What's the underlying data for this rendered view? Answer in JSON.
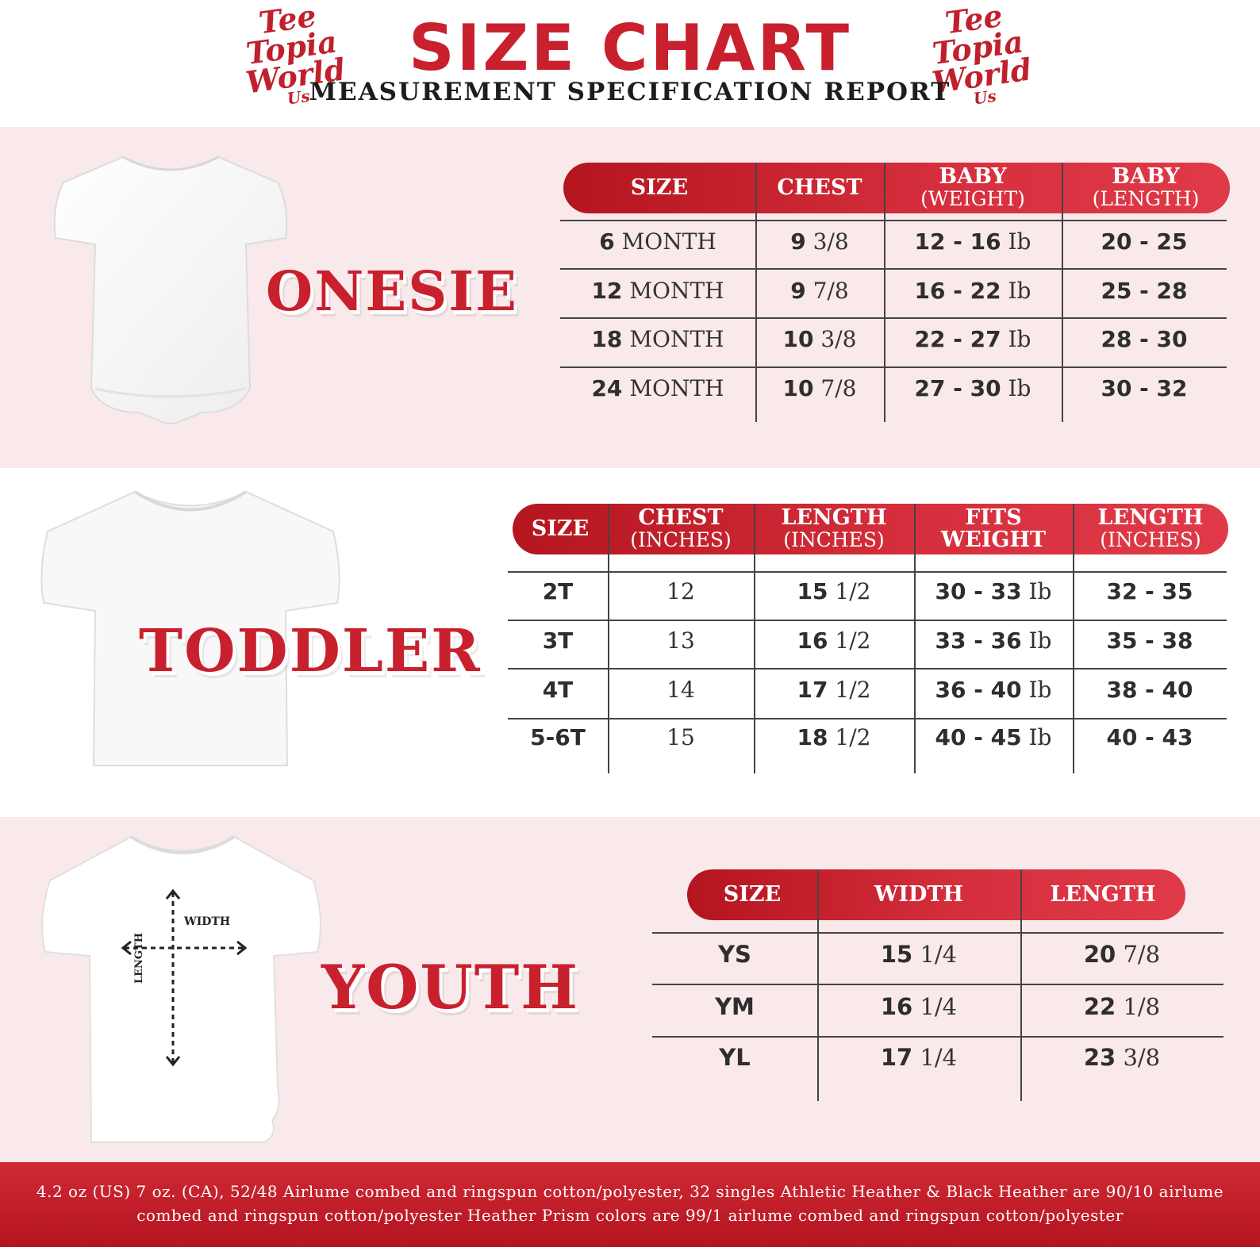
{
  "brand": {
    "line1": "Tee",
    "line2": "Topia",
    "line3": "World",
    "line4": "Us"
  },
  "header": {
    "title": "SIZE CHART",
    "subtitle": "MEASUREMENT SPECIFICATION REPORT"
  },
  "colors": {
    "accent": "#c8202d",
    "band": "#f9e9ea",
    "text": "#333333"
  },
  "onesie": {
    "label": "ONESIE",
    "headers": [
      {
        "main": "SIZE",
        "sub": ""
      },
      {
        "main": "CHEST",
        "sub": ""
      },
      {
        "main": "BABY",
        "sub": "(WEIGHT)"
      },
      {
        "main": "BABY",
        "sub": "(LENGTH)"
      }
    ],
    "rows": [
      [
        [
          "6",
          " MONTH"
        ],
        [
          "9",
          " 3/8"
        ],
        [
          "12 - 16",
          " Ib"
        ],
        [
          "20 - 25",
          ""
        ]
      ],
      [
        [
          "12",
          " MONTH"
        ],
        [
          "9",
          " 7/8"
        ],
        [
          "16 - 22",
          " Ib"
        ],
        [
          "25 - 28",
          ""
        ]
      ],
      [
        [
          "18",
          "  MONTH"
        ],
        [
          "10",
          " 3/8"
        ],
        [
          "22 - 27",
          " Ib"
        ],
        [
          "28 - 30",
          ""
        ]
      ],
      [
        [
          "24",
          " MONTH"
        ],
        [
          "10",
          " 7/8"
        ],
        [
          "27 - 30",
          " Ib"
        ],
        [
          "30 - 32",
          ""
        ]
      ]
    ]
  },
  "toddler": {
    "label": "TODDLER",
    "headers": [
      {
        "main": "SIZE",
        "sub": ""
      },
      {
        "main": "CHEST",
        "sub": "(INCHES)"
      },
      {
        "main": "LENGTH",
        "sub": "(INCHES)"
      },
      {
        "main": "FITS",
        "sub": "WEIGHT"
      },
      {
        "main": "LENGTH",
        "sub": "(INCHES)"
      }
    ],
    "rows": [
      [
        [
          "2T",
          ""
        ],
        [
          "",
          "12"
        ],
        [
          "15",
          " 1/2"
        ],
        [
          "30 - 33",
          " Ib"
        ],
        [
          "32 - 35",
          ""
        ]
      ],
      [
        [
          "3T",
          ""
        ],
        [
          "",
          "13"
        ],
        [
          "16",
          " 1/2"
        ],
        [
          "33 - 36",
          " Ib"
        ],
        [
          "35 - 38",
          ""
        ]
      ],
      [
        [
          "4T",
          ""
        ],
        [
          "",
          "14"
        ],
        [
          "17",
          " 1/2"
        ],
        [
          "36 - 40",
          " Ib"
        ],
        [
          "38 - 40",
          ""
        ]
      ],
      [
        [
          "5-6T",
          ""
        ],
        [
          "",
          "15"
        ],
        [
          "18",
          " 1/2"
        ],
        [
          "40 - 45",
          " Ib"
        ],
        [
          "40 - 43",
          ""
        ]
      ]
    ]
  },
  "youth": {
    "label": "YOUTH",
    "width_label": "WIDTH",
    "length_label": "LENGTH",
    "headers": [
      {
        "main": "SIZE",
        "sub": ""
      },
      {
        "main": "WIDTH",
        "sub": ""
      },
      {
        "main": "LENGTH",
        "sub": ""
      }
    ],
    "rows": [
      [
        [
          "YS",
          ""
        ],
        [
          "15",
          " 1/4"
        ],
        [
          "20",
          " 7/8"
        ]
      ],
      [
        [
          "YM",
          ""
        ],
        [
          "16",
          " 1/4"
        ],
        [
          "22",
          " 1/8"
        ]
      ],
      [
        [
          "YL",
          ""
        ],
        [
          "17",
          " 1/4"
        ],
        [
          "23",
          " 3/8"
        ]
      ]
    ]
  },
  "footer": {
    "text": "4.2 oz (US) 7 oz. (CA), 52/48 Airlume combed and ringspun cotton/polyester, 32 singles Athletic Heather & Black Heather are 90/10 airlume combed and ringspun cotton/polyester Heather Prism colors are 99/1 airlume combed and ringspun cotton/polyester"
  }
}
